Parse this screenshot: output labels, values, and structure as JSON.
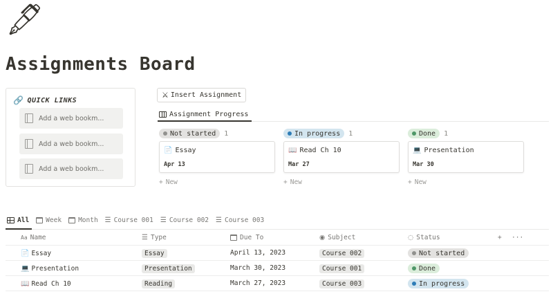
{
  "page": {
    "icon": "🖋",
    "title": "Assignments Board"
  },
  "quick_links": {
    "title": "QUICK LINKS",
    "items": [
      "Add a web bookm...",
      "Add a web bookm...",
      "Add a web bookm..."
    ]
  },
  "insert_button": {
    "icon": "⚔",
    "label": "Insert Assignment"
  },
  "board_view": {
    "tab_label": "Assignment Progress"
  },
  "columns": [
    {
      "status": "Not started",
      "count": "1",
      "pill_bg": "#e3e2e0",
      "dot": "#91918e",
      "card": {
        "emoji": "📄",
        "title": "Essay",
        "date": "Apr 13"
      },
      "new_label": "New"
    },
    {
      "status": "In progress",
      "count": "1",
      "pill_bg": "#d3e5ef",
      "dot": "#2e7db7",
      "card": {
        "emoji": "📖",
        "title": "Read Ch 10",
        "date": "Mar 27"
      },
      "new_label": "New"
    },
    {
      "status": "Done",
      "count": "1",
      "pill_bg": "#dbeddb",
      "dot": "#4f9768",
      "card": {
        "emoji": "💻",
        "title": "Presentation",
        "date": "Mar 30"
      },
      "new_label": "New"
    }
  ],
  "table_tabs": [
    "All",
    "Week",
    "Month",
    "Course 001",
    "Course 002",
    "Course 003"
  ],
  "table": {
    "headers": {
      "name": "Name",
      "type": "Type",
      "due": "Due To",
      "subject": "Subject",
      "status": "Status"
    },
    "rows": [
      {
        "emoji": "📄",
        "name": "Essay",
        "type": "Essay",
        "due": "April 13, 2023",
        "subject": "Course 002",
        "status": "Not started"
      },
      {
        "emoji": "💻",
        "name": "Presentation",
        "type": "Presentation",
        "due": "March 30, 2023",
        "subject": "Course 001",
        "status": "Done"
      },
      {
        "emoji": "📖",
        "name": "Read Ch 10",
        "type": "Reading",
        "due": "March 27, 2023",
        "subject": "Course 003",
        "status": "In progress"
      }
    ]
  }
}
